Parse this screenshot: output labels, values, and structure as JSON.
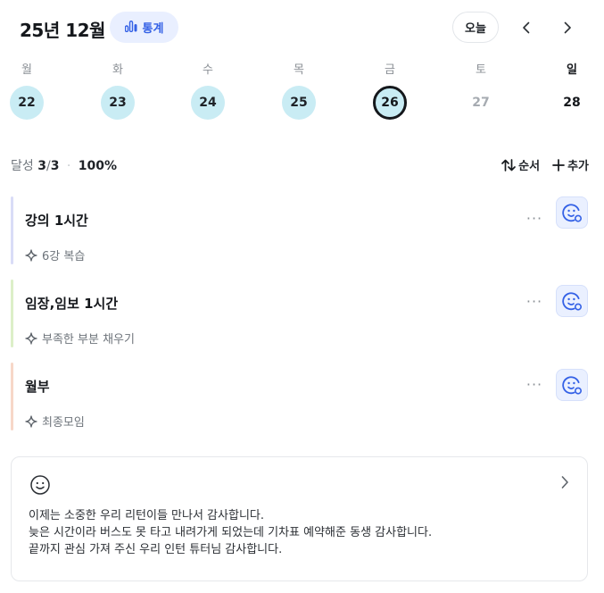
{
  "header": {
    "month_title": "25년 12월",
    "stats_label": "통계",
    "today_label": "오늘",
    "icons": {
      "stats": "bar-chart-icon",
      "prev": "chevron-left-icon",
      "next": "chevron-right-icon"
    }
  },
  "week": {
    "weekdays": [
      "월",
      "화",
      "수",
      "목",
      "금",
      "토",
      "일"
    ],
    "dates": [
      {
        "day": "22",
        "state": "done"
      },
      {
        "day": "23",
        "state": "done"
      },
      {
        "day": "24",
        "state": "done"
      },
      {
        "day": "25",
        "state": "done"
      },
      {
        "day": "26",
        "state": "selected"
      },
      {
        "day": "27",
        "state": "future"
      },
      {
        "day": "28",
        "state": "future"
      }
    ]
  },
  "summary": {
    "label": "달성",
    "done": "3",
    "slash": "/",
    "total": "3",
    "separator": "·",
    "percent": "100%"
  },
  "actions": {
    "sort_label": "순서",
    "add_label": "추가",
    "icons": {
      "sort": "sort-arrows-icon",
      "add": "plus-icon"
    }
  },
  "tasks": [
    {
      "title": "강의 1시간",
      "note": "6강 복습",
      "color": "#d9dcf7"
    },
    {
      "title": "임장,임보 1시간",
      "note": "부족한 부분 채우기",
      "color": "#dcefc8"
    },
    {
      "title": "월부",
      "note": "최종모임",
      "color": "#f7d7c8"
    }
  ],
  "task_more_label": "···",
  "journal": {
    "lines": [
      "이제는 소중한 우리 리턴이들 만나서 감사합니다.",
      "늦은 시간이라 버스도 못 타고 내려가게 되었는데 기차표 예약해준 동생 감사합니다.",
      "끝까지 관심 가져 주신 우리 인턴 튜터님 감사합니다."
    ]
  },
  "colors": {
    "accent": "#3461e6",
    "done_day": "#c9ecf4",
    "emoji_bg": "#eaf0ff"
  }
}
